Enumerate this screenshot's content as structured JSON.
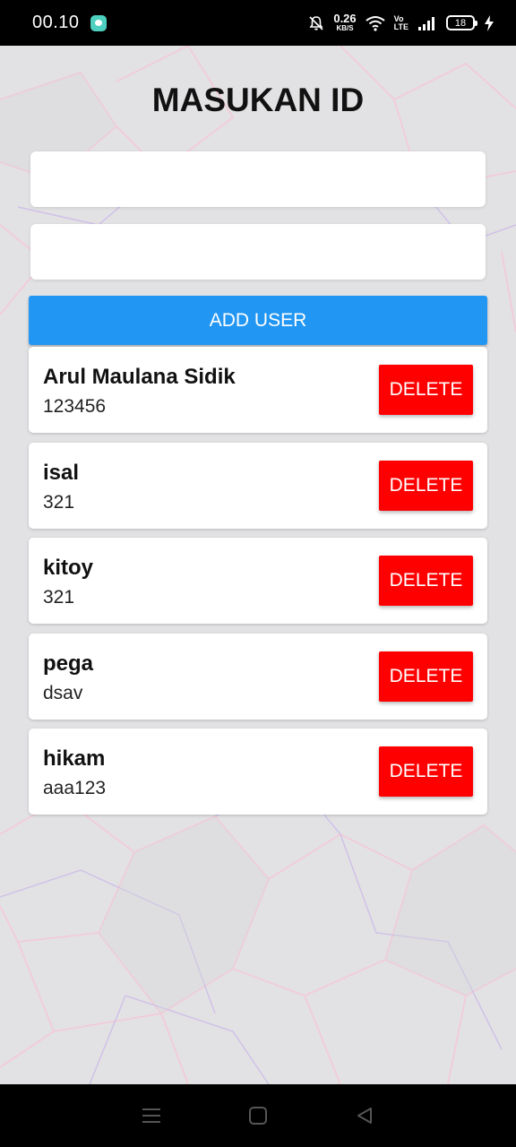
{
  "status_bar": {
    "time": "00.10",
    "net_speed_value": "0.26",
    "net_speed_unit": "KB/S",
    "volte_top": "Vo",
    "volte_bottom": "LTE",
    "battery_level": "18"
  },
  "page": {
    "title": "MASUKAN ID"
  },
  "form": {
    "name_input_value": "",
    "id_input_value": "",
    "add_button_label": "ADD USER"
  },
  "users": [
    {
      "name": "Arul Maulana Sidik",
      "id": "123456",
      "delete_label": "DELETE"
    },
    {
      "name": "isal",
      "id": "321",
      "delete_label": "DELETE"
    },
    {
      "name": "kitoy",
      "id": "321",
      "delete_label": "DELETE"
    },
    {
      "name": "pega",
      "id": "dsav",
      "delete_label": "DELETE"
    },
    {
      "name": "hikam",
      "id": "aaa123",
      "delete_label": "DELETE"
    }
  ],
  "colors": {
    "add_button": "#2196f3",
    "delete_button": "#ff0000",
    "background": "#e2e2e4"
  },
  "icons": {
    "status_left": "chat-bubble-icon",
    "status_right": [
      "bell-off-icon",
      "wifi-icon",
      "signal-icon",
      "battery-icon",
      "charging-bolt-icon"
    ],
    "nav": [
      "menu-icon",
      "home-square-icon",
      "back-triangle-icon"
    ]
  }
}
